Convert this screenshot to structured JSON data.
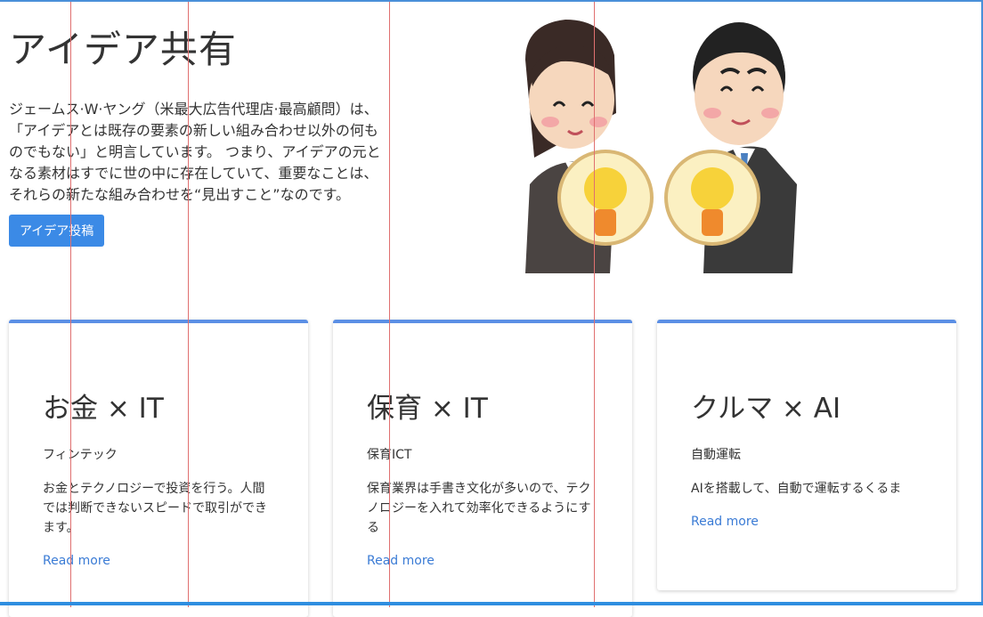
{
  "hero": {
    "title": "アイデア共有",
    "description": "ジェームス·W·ヤング（米最大広告代理店·最高顧問）は、「アイデアとは既存の要素の新しい組み合わせ以外の何ものでもない」と明言しています。 つまり、アイデアの元となる素材はすでに世の中に存在していて、重要なことは、それらの新たな組み合わせを“見出すこと”なのです。",
    "post_button": "アイデア投稿"
  },
  "cards": [
    {
      "title": "お金 × IT",
      "subtitle": "フィンテック",
      "description": "お金とテクノロジーで投資を行う。人間では判断できないスピードで取引ができます。",
      "link": "Read more"
    },
    {
      "title": "保育 × IT",
      "subtitle": "保育ICT",
      "description": "保育業界は手書き文化が多いので、テクノロジーを入れて効率化できるようにする",
      "link": "Read more"
    },
    {
      "title": "クルマ × AI",
      "subtitle": "自動運転",
      "description": "AIを搭載して、自動で運転するくるま",
      "link": "Read more"
    }
  ],
  "colors": {
    "accent": "#3b8ae6",
    "card_border": "#5b8fe5",
    "link": "#3a7bd5",
    "guide_line": "#e07070"
  },
  "illustration": {
    "icon_name": "business-people-holding-lightbulbs-illustration"
  }
}
